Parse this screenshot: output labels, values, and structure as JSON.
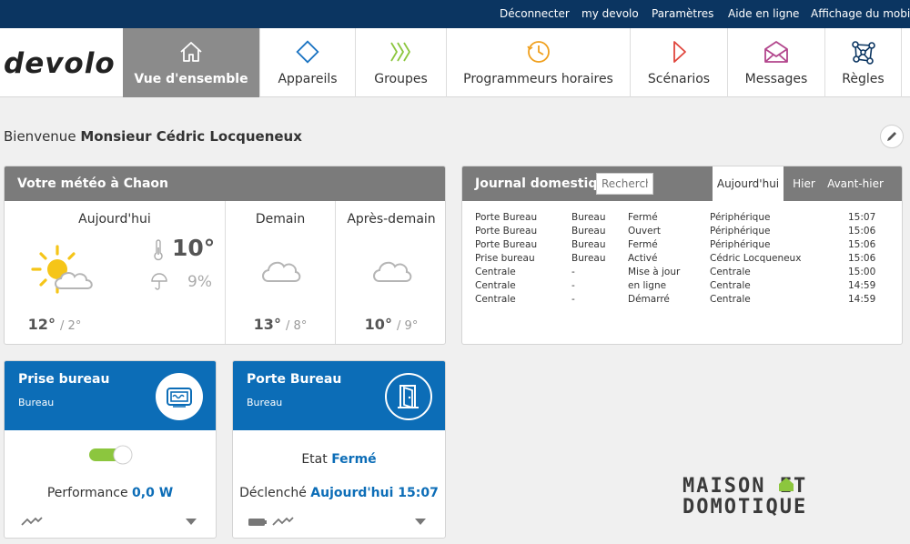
{
  "topbar": {
    "links": [
      {
        "label": "Déconnecter"
      },
      {
        "label": "my devolo"
      },
      {
        "label": "Paramètres"
      },
      {
        "label": "Aide en ligne"
      },
      {
        "label": "Affichage du mobile"
      }
    ]
  },
  "brand": {
    "logo_text": "devolo"
  },
  "nav": {
    "items": [
      {
        "label": "Vue d'ensemble",
        "icon": "home-icon",
        "active": true
      },
      {
        "label": "Appareils",
        "icon": "diamond-icon"
      },
      {
        "label": "Groupes",
        "icon": "chevrons-icon"
      },
      {
        "label": "Programmeurs horaires",
        "icon": "clock-icon"
      },
      {
        "label": "Scénarios",
        "icon": "play-icon"
      },
      {
        "label": "Messages",
        "icon": "envelope-icon"
      },
      {
        "label": "Règles",
        "icon": "network-icon"
      }
    ]
  },
  "welcome": {
    "prefix": "Bienvenue",
    "user": "Monsieur Cédric Locqueneux"
  },
  "weather": {
    "title": "Votre météo à Chaon",
    "today": {
      "label": "Aujourd'hui",
      "current_temp": "10°",
      "rain_chance": "9%",
      "max": "12°",
      "min": "/ 2°",
      "icon": "sun-cloud-icon"
    },
    "days": [
      {
        "label": "Demain",
        "max": "13°",
        "min": "/ 8°",
        "icon": "cloud-icon"
      },
      {
        "label": "Après-demain",
        "max": "10°",
        "min": "/ 9°",
        "icon": "cloud-icon"
      }
    ]
  },
  "journal": {
    "title": "Journal domestique",
    "search_placeholder": "Recherch",
    "tabs": [
      {
        "label": "Aujourd'hui",
        "active": true
      },
      {
        "label": "Hier"
      },
      {
        "label": "Avant-hier"
      }
    ],
    "rows": [
      [
        "Porte Bureau",
        "Bureau",
        "Fermé",
        "Périphérique",
        "15:07"
      ],
      [
        "Porte Bureau",
        "Bureau",
        "Ouvert",
        "Périphérique",
        "15:06"
      ],
      [
        "Porte Bureau",
        "Bureau",
        "Fermé",
        "Périphérique",
        "15:06"
      ],
      [
        "Prise bureau",
        "Bureau",
        "Activé",
        "Cédric Locqueneux",
        "15:06"
      ],
      [
        "Centrale",
        "-",
        "Mise à jour",
        "Centrale",
        "15:00"
      ],
      [
        "Centrale",
        "-",
        "en ligne",
        "Centrale",
        "14:59"
      ],
      [
        "Centrale",
        "-",
        "Démarré",
        "Centrale",
        "14:59"
      ]
    ]
  },
  "devices": [
    {
      "name": "Prise bureau",
      "room": "Bureau",
      "icon": "plug-icon",
      "toggle_on": true,
      "metric_label": "Performance",
      "metric_value": "0,0 W"
    },
    {
      "name": "Porte Bureau",
      "room": "Bureau",
      "icon": "door-icon",
      "state_label": "Etat",
      "state_value": "Fermé",
      "trigger_label": "Déclenché",
      "trigger_value": "Aujourd'hui 15:07"
    }
  ],
  "watermark": {
    "line1": "MAISON ET",
    "line2": "DOMOTIQUE"
  },
  "colors": {
    "topbar": "#0b3561",
    "accent_blue": "#0c6db7",
    "nav_active": "#8b8b8b",
    "card_header": "#7b7b7b",
    "toggle_green": "#8cc63e",
    "sun": "#f5c518"
  }
}
